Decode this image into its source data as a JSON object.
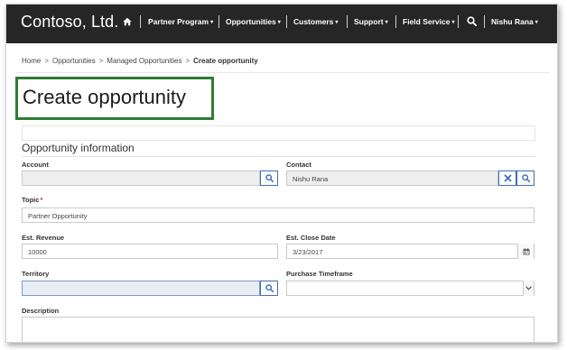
{
  "brand": "Contoso, Ltd.",
  "nav": {
    "items": [
      {
        "label": "Partner Program",
        "has_caret": true
      },
      {
        "label": "Opportunities",
        "has_caret": true
      },
      {
        "label": "Customers",
        "has_caret": true
      },
      {
        "label": "Support",
        "has_caret": true
      },
      {
        "label": "Field Service",
        "has_caret": true
      }
    ],
    "user": "Nishu Rana",
    "caret": "▾"
  },
  "breadcrumb": {
    "items": [
      "Home",
      "Opportunities",
      "Managed Opportunities"
    ],
    "current": "Create opportunity",
    "separator": ">"
  },
  "page_title": "Create opportunity",
  "section_title": "Opportunity information",
  "form": {
    "account": {
      "label": "Account",
      "value": ""
    },
    "contact": {
      "label": "Contact",
      "value": "Nishu Rana"
    },
    "topic": {
      "label": "Topic",
      "required_mark": "*",
      "value": "Partner Opportunity"
    },
    "est_revenue": {
      "label": "Est. Revenue",
      "value": "10000"
    },
    "est_close_date": {
      "label": "Est. Close Date",
      "value": "3/23/2017"
    },
    "territory": {
      "label": "Territory",
      "value": ""
    },
    "purchase_timeframe": {
      "label": "Purchase Timeframe",
      "value": ""
    },
    "description": {
      "label": "Description",
      "value": ""
    }
  },
  "colors": {
    "navbar": "#262626",
    "highlight_border": "#2e7d32",
    "button_border": "#3d6fb6",
    "required": "#c0392b"
  },
  "icons": {
    "home": "home-icon",
    "search": "search-icon",
    "clear": "close-icon",
    "calendar": "calendar-icon",
    "dropdown": "chevron-down-icon"
  }
}
